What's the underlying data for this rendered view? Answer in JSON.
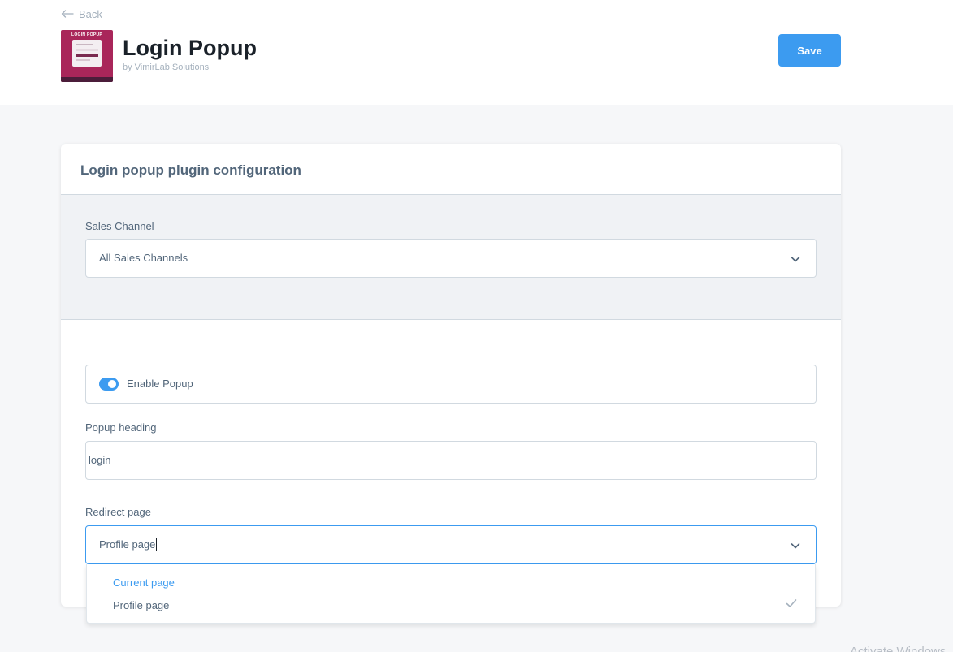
{
  "header": {
    "back_label": "Back",
    "title": "Login Popup",
    "subtitle": "by VimirLab Solutions",
    "save_label": "Save",
    "thumbnail": {
      "title": "LOGIN POPUP",
      "background": "#a9265a"
    }
  },
  "card": {
    "title": "Login popup plugin configuration"
  },
  "sales_channel": {
    "label": "Sales Channel",
    "value": "All Sales Channels"
  },
  "enable_popup": {
    "label": "Enable Popup",
    "enabled": true
  },
  "popup_heading": {
    "label": "Popup heading",
    "value": "login"
  },
  "redirect_page": {
    "label": "Redirect page",
    "value": "Profile page",
    "options": [
      {
        "label": "Current page",
        "highlighted": true
      },
      {
        "label": "Profile page",
        "selected": true
      }
    ]
  },
  "colors": {
    "accent": "#3c9bf0",
    "text": "#52667a",
    "title": "#1a2129"
  },
  "watermark": "Activate Windows"
}
